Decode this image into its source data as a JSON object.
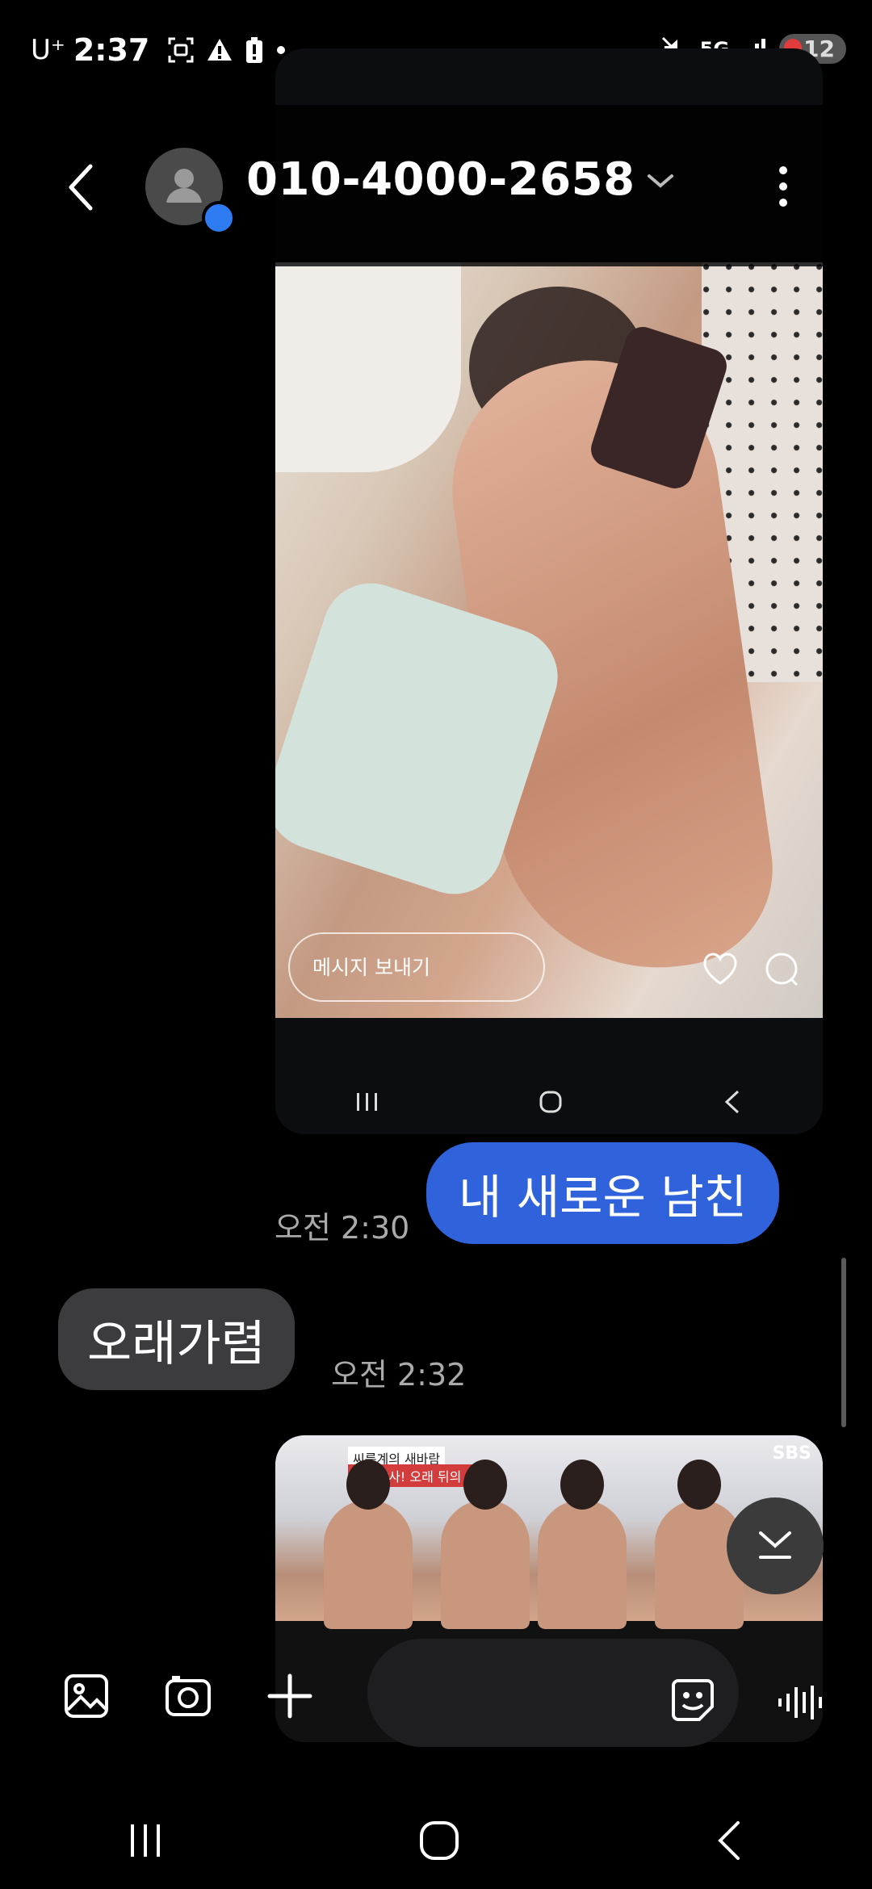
{
  "status_bar": {
    "carrier": "U⁺",
    "time": "2:37",
    "network": "5G",
    "battery": "12"
  },
  "header": {
    "contact_name": "010-4000-2658"
  },
  "shared_screenshot": {
    "message_placeholder": "메시지 보내기"
  },
  "messages": [
    {
      "direction": "outgoing",
      "text": "내 새로운 남친",
      "time": "오전 2:30"
    },
    {
      "direction": "incoming",
      "text": "오래가렴",
      "time": "오전 2:32"
    }
  ],
  "video_preview": {
    "label_top": "씨름계의 새바람",
    "label_sub": "신흥장사! 오래 뒤의 F4",
    "channel": "SBS"
  },
  "colors": {
    "outgoing_bubble": "#2f62db",
    "incoming_bubble": "#3c3c3e",
    "background": "#000000"
  }
}
